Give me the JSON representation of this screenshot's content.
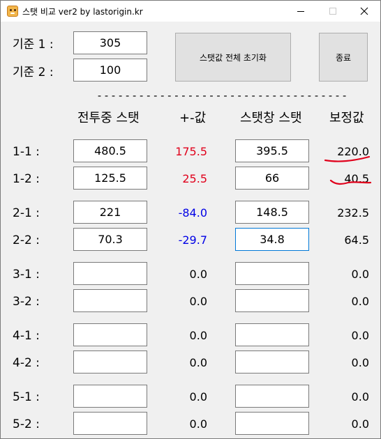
{
  "window": {
    "title": "스탯 비교 ver2 by lastorigin.kr"
  },
  "base": {
    "label1": "기준 1 :",
    "value1": "305",
    "label2": "기준 2 :",
    "value2": "100"
  },
  "buttons": {
    "reset": "스탯값 전체 초기화",
    "exit": "종료"
  },
  "separator": "------------------------------------",
  "headers": {
    "battle": "전투중 스탯",
    "diff": "+-값",
    "window": "스탯창 스탯",
    "corrected": "보정값"
  },
  "rows": [
    {
      "label": "1-1 :",
      "battle": "480.5",
      "diff": "175.5",
      "window": "395.5",
      "corrected": "220.0"
    },
    {
      "label": "1-2 :",
      "battle": "125.5",
      "diff": "25.5",
      "window": "66",
      "corrected": "40.5"
    },
    {
      "label": "2-1 :",
      "battle": "221",
      "diff": "-84.0",
      "window": "148.5",
      "corrected": "232.5"
    },
    {
      "label": "2-2 :",
      "battle": "70.3",
      "diff": "-29.7",
      "window": "34.8",
      "corrected": "64.5"
    },
    {
      "label": "3-1 :",
      "battle": "",
      "diff": "0.0",
      "window": "",
      "corrected": "0.0"
    },
    {
      "label": "3-2 :",
      "battle": "",
      "diff": "0.0",
      "window": "",
      "corrected": "0.0"
    },
    {
      "label": "4-1 :",
      "battle": "",
      "diff": "0.0",
      "window": "",
      "corrected": "0.0"
    },
    {
      "label": "4-2 :",
      "battle": "",
      "diff": "0.0",
      "window": "",
      "corrected": "0.0"
    },
    {
      "label": "5-1 :",
      "battle": "",
      "diff": "0.0",
      "window": "",
      "corrected": "0.0"
    },
    {
      "label": "5-2 :",
      "battle": "",
      "diff": "0.0",
      "window": "",
      "corrected": "0.0"
    }
  ],
  "colors": {
    "positive": "#e0001b",
    "negative": "#0000e6",
    "annotation": "#e0001b",
    "focus_border": "#0078d7"
  }
}
